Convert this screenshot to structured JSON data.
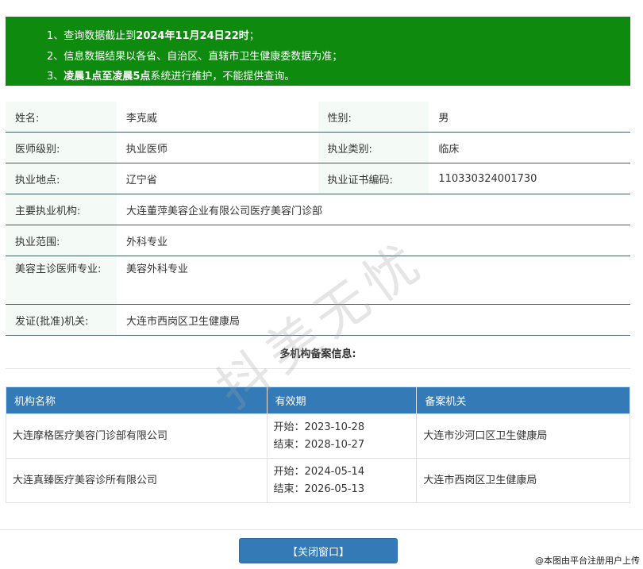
{
  "notice": {
    "line1_pre": "1、查询数据截止到",
    "line1_bold": "2024年11月24日22时",
    "line1_post": "；",
    "line2": "2、信息数据结果以各省、自治区、直辖市卫生健康委数据为准；",
    "line3_pre": "3、",
    "line3_bold": "凌晨1点至凌晨5点",
    "line3_post": "系统进行维护，不能提供查询。"
  },
  "info": {
    "name_label": "姓名:",
    "name": "李克威",
    "gender_label": "性别:",
    "gender": "男",
    "level_label": "医师级别:",
    "level": "执业医师",
    "category_label": "执业类别:",
    "category": "临床",
    "location_label": "执业地点:",
    "location": "辽宁省",
    "cert_label": "执业证书编码:",
    "cert": "110330324001730",
    "institution_label": "主要执业机构:",
    "institution": "大连董萍美容企业有限公司医疗美容门诊部",
    "scope_label": "执业范围:",
    "scope": "外科专业",
    "cosmetic_label": "美容主诊医师专业:",
    "cosmetic": "美容外科专业",
    "authority_label": "发证(批准)机关:",
    "authority": "大连市西岗区卫生健康局"
  },
  "multi": {
    "title": "多机构备案信息:",
    "headers": [
      "机构名称",
      "有效期",
      "备案机关"
    ],
    "rows": [
      {
        "org": "大连摩格医疗美容门诊部有限公司",
        "start": "开始：2023-10-28",
        "end": "结束：2028-10-27",
        "authority": "大连市沙河口区卫生健康局"
      },
      {
        "org": "大连真臻医疗美容诊所有限公司",
        "start": "开始：2024-05-14",
        "end": "结束：2026-05-13",
        "authority": "大连市西岗区卫生健康局"
      }
    ]
  },
  "close_label": "【关闭窗口】",
  "watermark": "抖美无忧",
  "credit": "@本图由平台注册用户上传"
}
